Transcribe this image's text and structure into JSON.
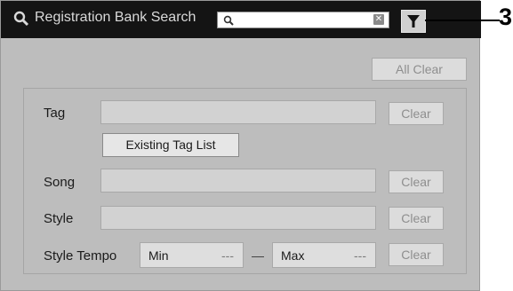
{
  "titlebar": {
    "title": "Registration Bank Search",
    "search_value": "",
    "clear_icon": "clear-x-icon",
    "filter_icon": "filter-funnel-icon"
  },
  "callout": {
    "number": "3"
  },
  "actions": {
    "all_clear_label": "All Clear"
  },
  "criteria": {
    "tag": {
      "label": "Tag",
      "value": "",
      "clear_label": "Clear",
      "existing_tag_label": "Existing Tag List"
    },
    "song": {
      "label": "Song",
      "value": "",
      "clear_label": "Clear"
    },
    "style": {
      "label": "Style",
      "value": "",
      "clear_label": "Clear"
    },
    "tempo": {
      "label": "Style Tempo",
      "min_label": "Min",
      "min_value": "---",
      "separator": "—",
      "max_label": "Max",
      "max_value": "---",
      "clear_label": "Clear"
    }
  },
  "colors": {
    "titlebar_bg": "#141414",
    "screen_bg": "#bdbdbd",
    "field_bg": "#d2d2d2"
  }
}
